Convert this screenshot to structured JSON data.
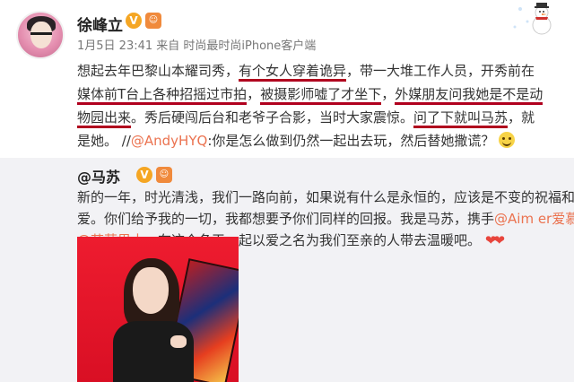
{
  "post": {
    "author": "徐峰立",
    "verified_badge": "V",
    "mood_badge": "😊",
    "timestamp": "1月5日 23:41",
    "source": "来自 时尚最时尚iPhone客户端",
    "lines": {
      "l1_a": "想起去年巴黎山本耀司秀，",
      "l1_b": "有个女人穿着诡异",
      "l1_c": "，带一大堆工作人员，开秀前在",
      "l2_a": "媒体前T台上各种招摇过市拍",
      "l2_b": "，",
      "l2_c": "被摄影师嘘了才坐下",
      "l2_d": "，",
      "l2_e": "外媒朋友问我她是不是动",
      "l3_a": "物园出来",
      "l3_b": "。秀后硬闯后台和老爷子合影，当时大家震惊。",
      "l3_c": "问了下就叫马苏",
      "l3_d": "，就",
      "l4_a": "是她。 //",
      "l4_mention": "@AndyHYQ",
      "l4_b": ":你是怎么做到仍然一起出去玩，然后替她撒谎？"
    }
  },
  "repost": {
    "author": "@马苏",
    "verified_badge": "V",
    "mood_badge": "😊",
    "lines": {
      "r1": "新的一年，时光清浅，我们一路向前，如果说有什么是永恒的，应该是不变的祝福和",
      "r2": "爱。你们给予我的一切，我都想要予你们同样的回报。我是马苏，携手",
      "r2_mention": "@Aim er爱慕",
      "r3_mention": "@芭莎男士",
      "r3_b": "，在这个冬天一起以爱之名为我们至亲的人带去温暖吧。",
      "hearts": "❤❤"
    }
  },
  "colors": {
    "underline": "#b0001e",
    "mention": "#eb7350",
    "repost_bg": "#f2f2f5"
  }
}
